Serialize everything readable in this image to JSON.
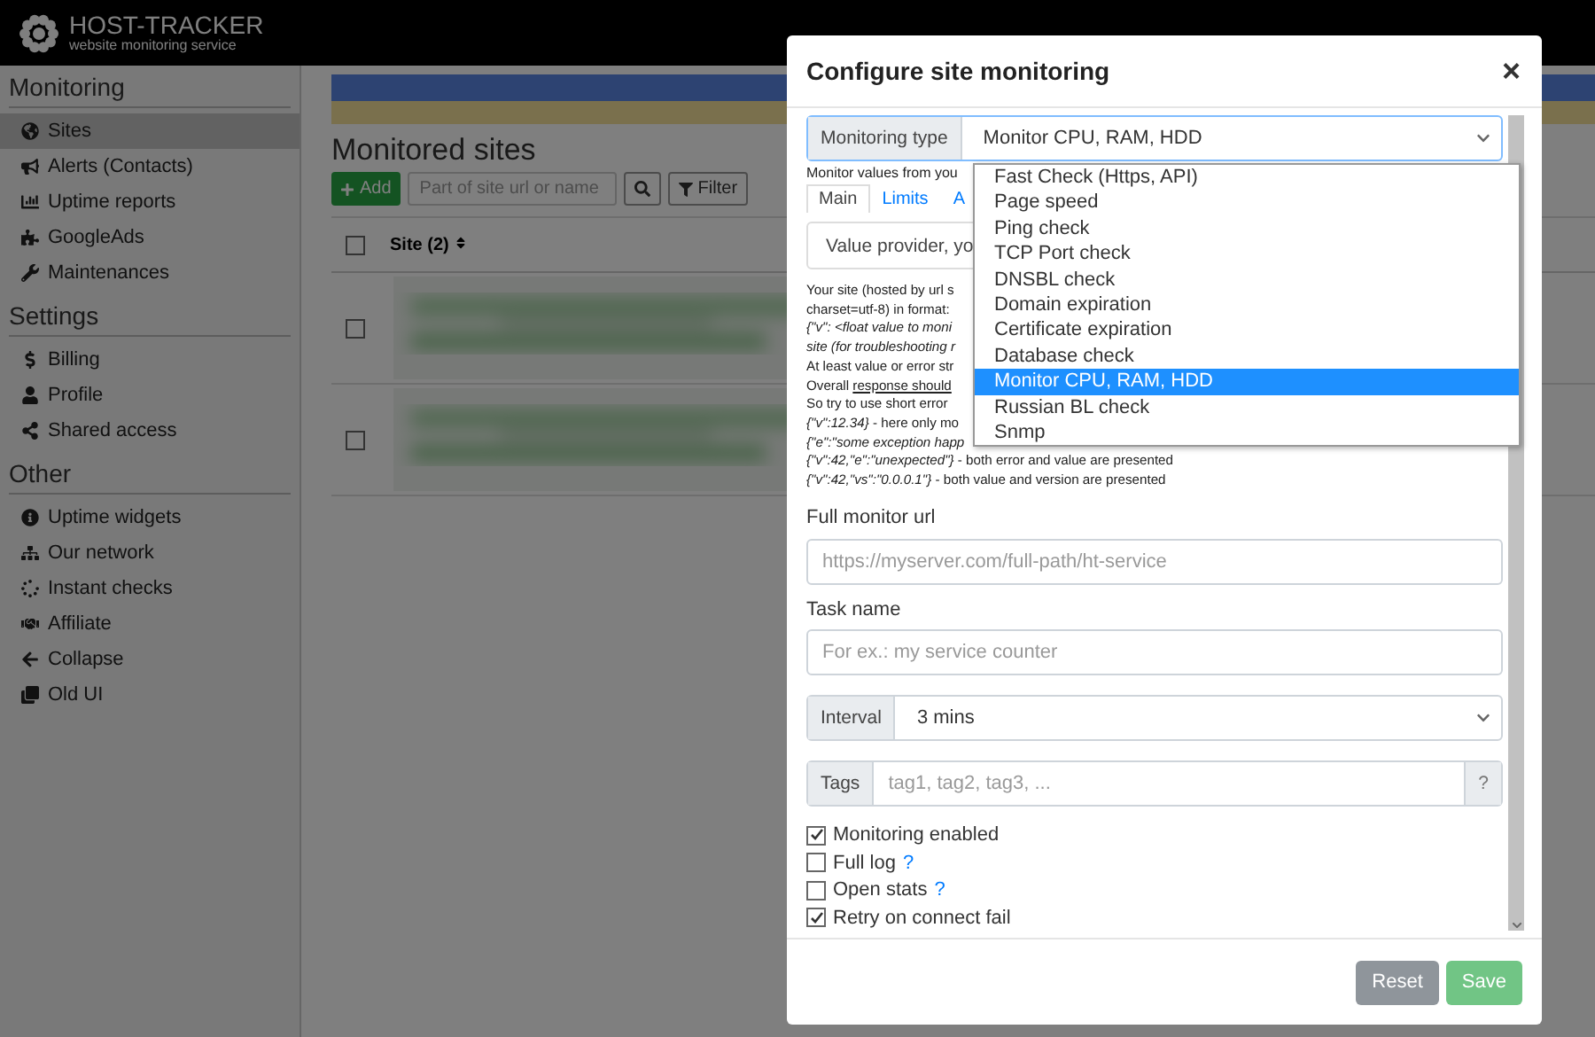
{
  "header": {
    "logo_title": "HOST-TRACKER",
    "logo_subtitle": "website monitoring service"
  },
  "sidebar": {
    "sections": [
      {
        "title": "Monitoring",
        "items": [
          {
            "label": "Sites",
            "selected": true
          },
          {
            "label": "Alerts (Contacts)",
            "selected": false
          },
          {
            "label": "Uptime reports",
            "selected": false
          },
          {
            "label": "GoogleAds",
            "selected": false
          },
          {
            "label": "Maintenances",
            "selected": false
          }
        ]
      },
      {
        "title": "Settings",
        "items": [
          {
            "label": "Billing",
            "selected": false
          },
          {
            "label": "Profile",
            "selected": false
          },
          {
            "label": "Shared access",
            "selected": false
          }
        ]
      },
      {
        "title": "Other",
        "items": [
          {
            "label": "Uptime widgets",
            "selected": false
          },
          {
            "label": "Our network",
            "selected": false
          },
          {
            "label": "Instant checks",
            "selected": false
          },
          {
            "label": "Affiliate",
            "selected": false
          },
          {
            "label": "Collapse",
            "selected": false
          },
          {
            "label": "Old UI",
            "selected": false
          }
        ]
      }
    ]
  },
  "main": {
    "title": "Monitored sites",
    "add_button": "Add",
    "search": {
      "placeholder": "Part of site url or name"
    },
    "filter_button": "Filter",
    "table": {
      "select_all": {
        "checked": false
      },
      "columns": [
        "Site (2)"
      ],
      "rows": [
        {
          "checked": false
        },
        {
          "checked": false
        }
      ]
    }
  },
  "modal": {
    "title": "Configure site monitoring",
    "close": "×",
    "monitoring_type": {
      "label": "Monitoring type",
      "value": "Monitor CPU, RAM, HDD",
      "expanded": true,
      "options": [
        {
          "label": "Fast Check (Https, API)",
          "selected": false
        },
        {
          "label": "Page speed",
          "selected": false
        },
        {
          "label": "Ping check",
          "selected": false
        },
        {
          "label": "TCP Port check",
          "selected": false
        },
        {
          "label": "DNSBL check",
          "selected": false
        },
        {
          "label": "Domain expiration",
          "selected": false
        },
        {
          "label": "Certificate expiration",
          "selected": false
        },
        {
          "label": "Database check",
          "selected": false
        },
        {
          "label": "Monitor CPU, RAM, HDD",
          "selected": true
        },
        {
          "label": "Russian BL check",
          "selected": false
        },
        {
          "label": "Snmp",
          "selected": false
        }
      ]
    },
    "help_text": "Monitor values from you",
    "tabs": [
      {
        "label": "Main",
        "selected": true
      },
      {
        "label": "Limits",
        "selected": false
      },
      {
        "label": "A",
        "selected": false
      }
    ],
    "value_provider": "Value provider, yo",
    "description": [
      {
        "text": "Your site (hosted by url s"
      },
      {
        "text": "charset=utf-8) in format:"
      },
      {
        "text": "*{\"v\": <float value to moni*"
      },
      {
        "text": "*site (for troubleshooting r*"
      },
      {
        "text": "At least value or error str"
      },
      {
        "text": "Overall ",
        "link": "response should"
      },
      {
        "text": "So try to use short error"
      },
      {
        "text": "*{\"v\":12.34}* - here only mo"
      },
      {
        "text": "*{\"e\":\"some exception happ*"
      },
      {
        "text": "*{\"v\":42,\"e\":\"unexpected\"}* - both error and value are presented"
      },
      {
        "text": "*{\"v\":42,\"vs\":\"0.0.0.1\"}* - both value and version are presented"
      }
    ],
    "url": {
      "label": "Full monitor url",
      "placeholder": "https://myserver.com/full-path/ht-service"
    },
    "task": {
      "label": "Task name",
      "placeholder": "For ex.: my service counter"
    },
    "interval": {
      "label": "Interval",
      "value": "3 mins"
    },
    "tags": {
      "label": "Tags",
      "placeholder": "tag1, tag2, tag3, ...",
      "help": "?"
    },
    "options": [
      {
        "label": "Monitoring enabled",
        "checked": true
      },
      {
        "label": "Full log",
        "checked": false,
        "help": "?"
      },
      {
        "label": "Open stats",
        "checked": false,
        "help": "?"
      },
      {
        "label": "Retry on connect fail",
        "checked": true
      }
    ],
    "buttons": [
      {
        "label": "Reset",
        "kind": "secondary"
      },
      {
        "label": "Save",
        "kind": "primary"
      }
    ]
  }
}
